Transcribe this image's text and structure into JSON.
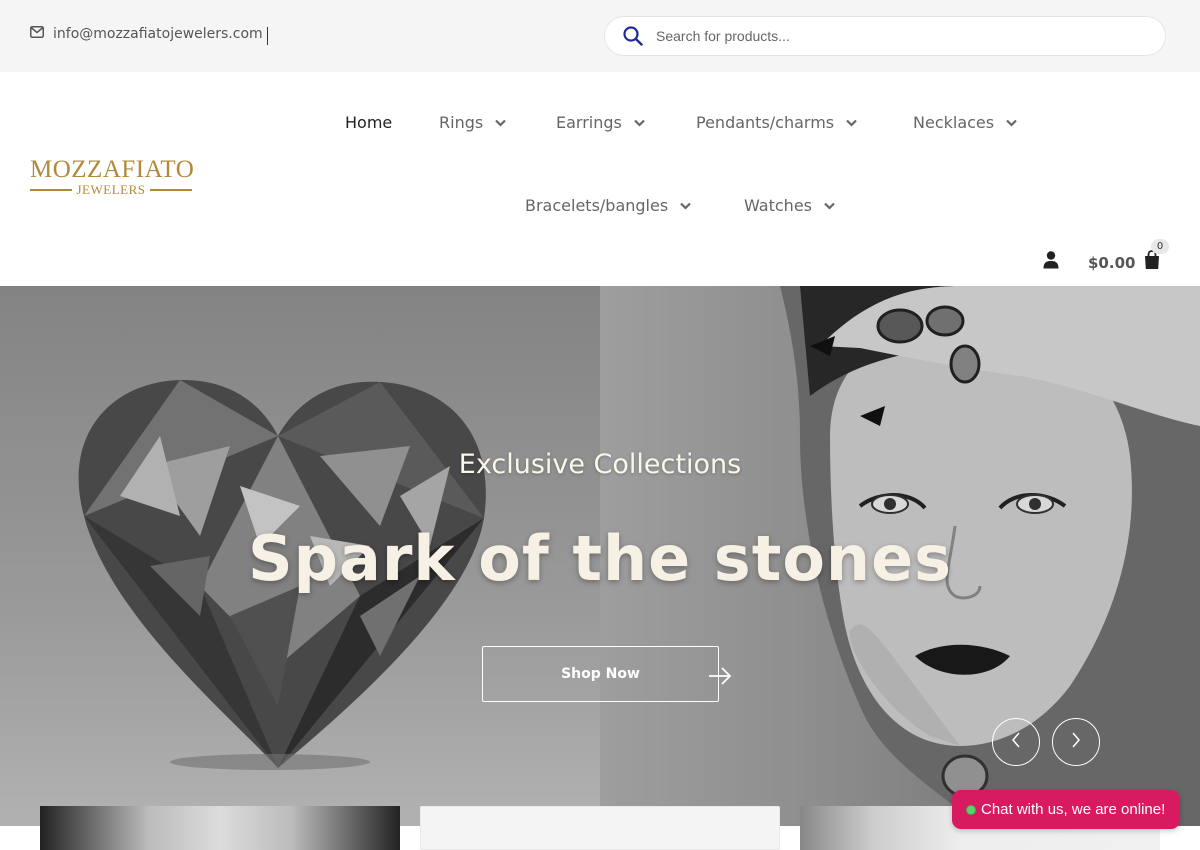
{
  "topbar": {
    "email": "info@mozzafiatojewelers.com",
    "search_placeholder": "Search for products..."
  },
  "logo": {
    "line1": "MOZZAFIATO",
    "line2": "JEWELERS",
    "color": "#b08a3a"
  },
  "nav": {
    "items": [
      {
        "label": "Home",
        "active": true,
        "dropdown": false
      },
      {
        "label": "Rings",
        "dropdown": true
      },
      {
        "label": "Earrings",
        "dropdown": true
      },
      {
        "label": "Pendants/charms",
        "dropdown": true
      },
      {
        "label": "Necklaces",
        "dropdown": true
      },
      {
        "label": "Bracelets/bangles",
        "dropdown": true
      },
      {
        "label": "Watches",
        "dropdown": true
      }
    ]
  },
  "header_icons": {
    "user_icon": "user-icon",
    "cart_icon": "shopping-bag-icon",
    "cart_total": "$0.00",
    "cart_count": "0"
  },
  "hero": {
    "subtitle": "Exclusive Collections",
    "title": "Spark of the stones",
    "cta_label": "Shop Now",
    "prev_icon": "chevron-left-icon",
    "next_icon": "chevron-right-icon"
  },
  "chat": {
    "label": "Chat with us, we are online!",
    "status_color": "#5ad36a",
    "bg_color": "#d81b60"
  }
}
